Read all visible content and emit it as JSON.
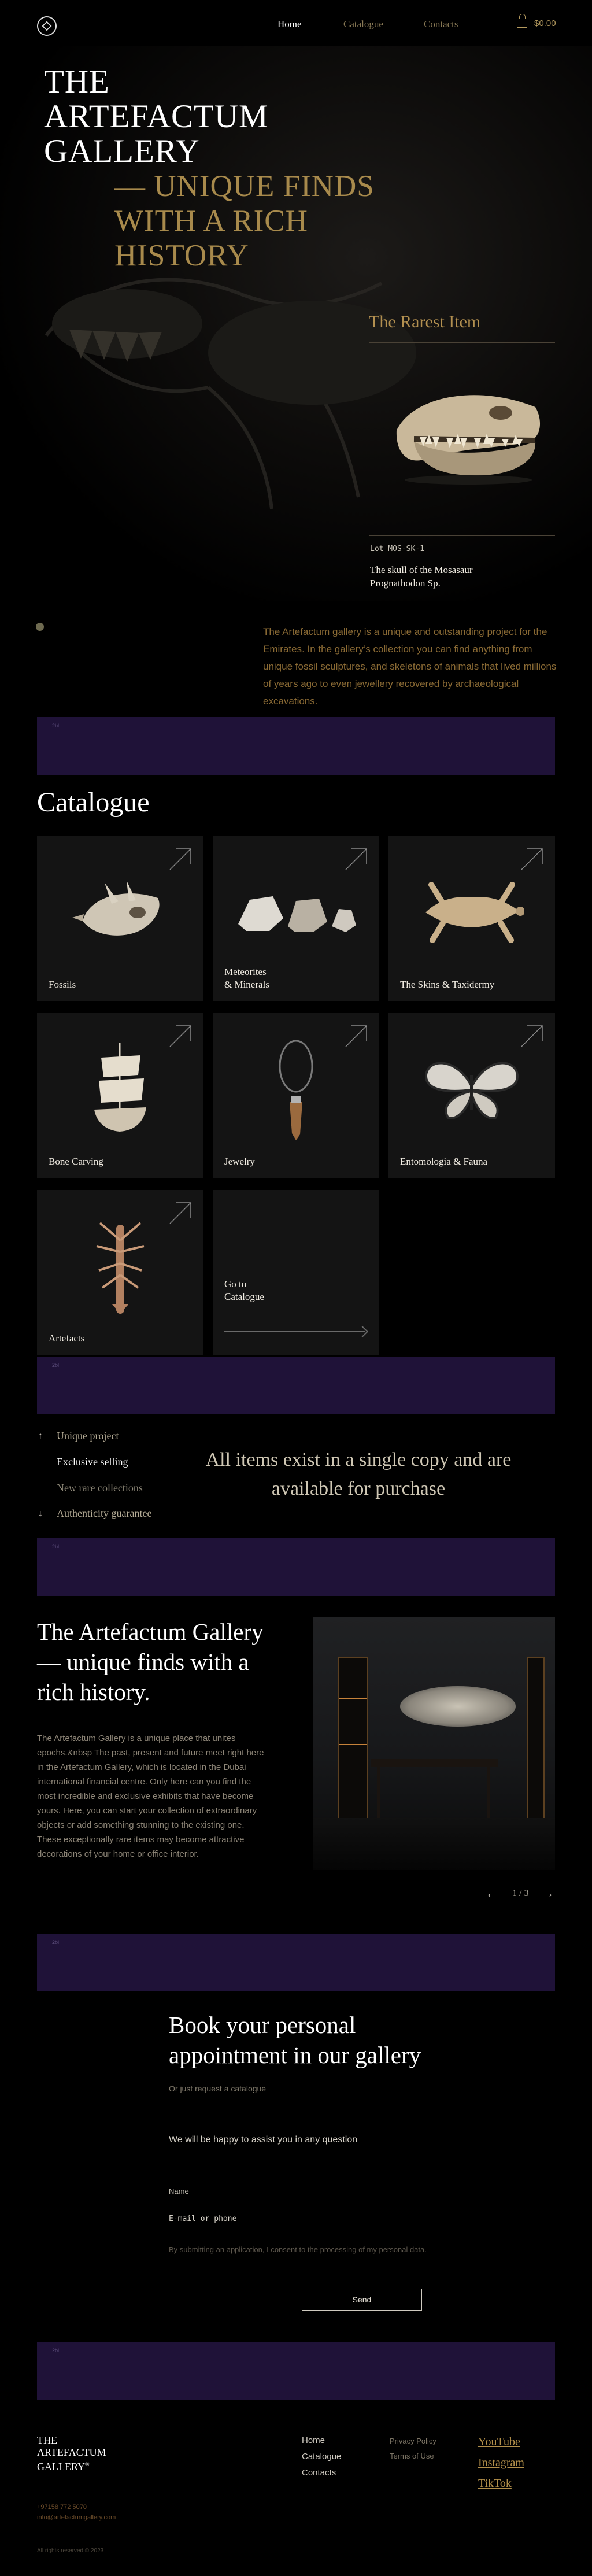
{
  "header": {
    "nav": [
      "Home",
      "Catalogue",
      "Contacts"
    ],
    "cart_sum": "$0.00"
  },
  "banners": [
    "2b",
    "2bl",
    "2bl",
    "2bl",
    "2bl",
    "2bl"
  ],
  "hero": {
    "title_lines": [
      "THE",
      "ARTEFACTUM",
      "GALLERY"
    ],
    "subtitle_lines": [
      "— UNIQUE FINDS",
      "WITH A RICH",
      "HISTORY"
    ],
    "rarest_label": "The Rarest Item",
    "lot": "Lot MOS-SK-1",
    "item_name": [
      "The skull of the Mosasaur",
      "Prognathodon Sp."
    ],
    "about": "The Artefactum gallery is a unique and outstanding project for the Emirates. In the gallery’s collection you can find anything from unique fossil sculptures, and skeletons of animals that lived millions of years ago to even jewellery recovered by archaeological excavations."
  },
  "catalogue": {
    "title": "Catalogue",
    "cards": [
      {
        "label": "Fossils"
      },
      {
        "label": "Meteorites\n& Minerals"
      },
      {
        "label": "The Skins & Taxidermy"
      },
      {
        "label": "Bone Carving"
      },
      {
        "label": "Jewelry"
      },
      {
        "label": "Entomologia & Fauna"
      },
      {
        "label": "Artefacts"
      }
    ],
    "goto": "Go to\nCatalogue"
  },
  "features": {
    "items": [
      "Unique project",
      "Exclusive selling",
      "New rare collections",
      "Authenticity guarantee"
    ],
    "headline": "All items exist in a single copy and are available for purchase"
  },
  "gallery": {
    "title": "The Artefactum Gallery — unique finds with a rich history.",
    "text": "The Artefactum Gallery is a unique place that unites epochs.&nbsp The past, present and future meet right here in the Artefactum Gallery, which is located in the Dubai international financial centre.  Only here can you find the most incredible and exclusive exhibits that have become yours. Here, you can start your collection of extraordinary objects or add something stunning to the existing one. These exceptionally rare items may become attractive decorations of your home or office interior.",
    "pager": "1 / 3"
  },
  "booking": {
    "title": "Book your personal appointment in our gallery",
    "subtitle": "Or just request a catalogue",
    "assist": "We will be happy to assist you in any question",
    "name_label": "Name",
    "contact_placeholder": "E-mail or phone",
    "consent": "By submitting an application, I consent to the processing of my personal data.",
    "send": "Send"
  },
  "footer": {
    "logo": [
      "THE",
      "ARTEFACTUM",
      "GALLERY"
    ],
    "links": [
      "Home",
      "Catalogue",
      "Contacts"
    ],
    "legal": [
      "Privacy Policy",
      "Terms of Use"
    ],
    "social": [
      "YouTube",
      "Instagram",
      "TikTok"
    ],
    "phone": "+97158 772 5070",
    "email": "info@artefactumgallery.com",
    "copyright": "All rights reserved © 2023"
  }
}
